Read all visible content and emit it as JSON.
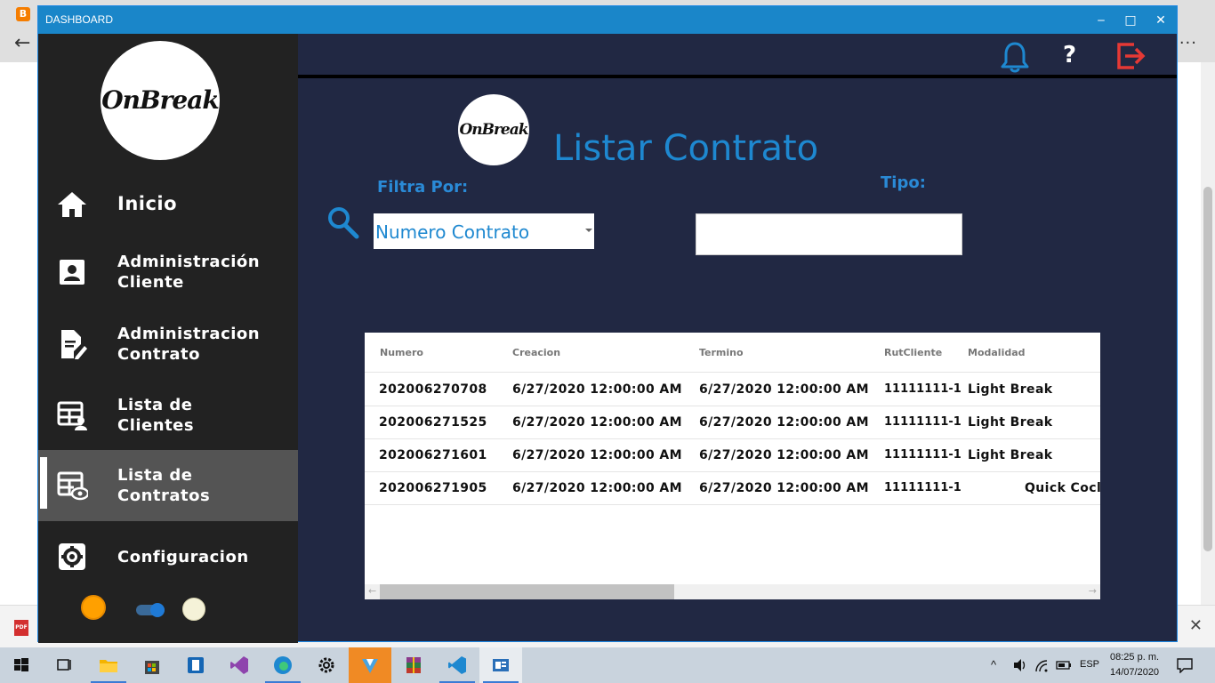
{
  "window": {
    "title": "DASHBOARD",
    "minimize": "‒",
    "maximize": "□",
    "close": "✕"
  },
  "brand": {
    "logo_text": "OnBreak"
  },
  "sidebar": {
    "items": [
      {
        "label": "Inicio",
        "icon": "home-icon"
      },
      {
        "label": "Administración Cliente",
        "icon": "contact-card-icon"
      },
      {
        "label": "Administracion Contrato",
        "icon": "document-edit-icon"
      },
      {
        "label": "Lista de Clientes",
        "icon": "table-user-icon"
      },
      {
        "label": "Lista de Contratos",
        "icon": "table-eye-icon",
        "active": true
      },
      {
        "label": "Configuracion",
        "icon": "gear-icon"
      }
    ],
    "theme": {
      "light_icon": "sun-icon",
      "dark_icon": "moon-icon",
      "toggle_on": true
    }
  },
  "topbar": {
    "notification_icon": "bell-icon",
    "help_label": "?",
    "logout_icon": "logout-icon",
    "accent_blue": "#1e88d0",
    "logout_red": "#e53935"
  },
  "main": {
    "title": "Listar Contrato",
    "filter_label": "Filtra Por:",
    "filter_value": "Numero Contrato",
    "type_label": "Tipo:",
    "type_value": ""
  },
  "grid": {
    "columns": [
      "Numero",
      "Creacion",
      "Termino",
      "RutCliente",
      "Modalidad"
    ],
    "rows": [
      [
        "202006270708",
        "6/27/2020 12:00:00 AM",
        "6/27/2020 12:00:00 AM",
        "11111111-1",
        "Light Break"
      ],
      [
        "202006271525",
        "6/27/2020 12:00:00 AM",
        "6/27/2020 12:00:00 AM",
        "11111111-1",
        "Light Break"
      ],
      [
        "202006271601",
        "6/27/2020 12:00:00 AM",
        "6/27/2020 12:00:00 AM",
        "11111111-1",
        "Light Break"
      ],
      [
        "202006271905",
        "6/27/2020 12:00:00 AM",
        "6/27/2020 12:00:00 AM",
        "11111111-1",
        "Quick Cocl"
      ]
    ]
  },
  "taskbar": {
    "language": "ESP",
    "time": "08:25 p. m.",
    "date": "14/07/2020"
  }
}
